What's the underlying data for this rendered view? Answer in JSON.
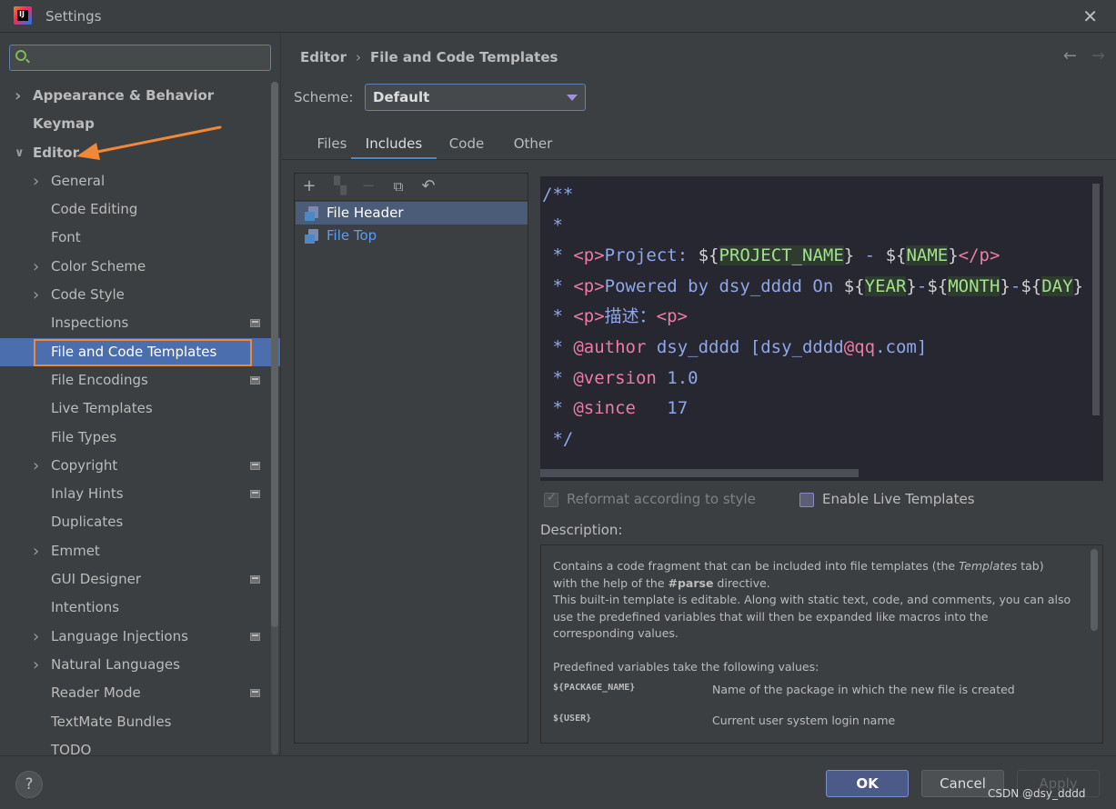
{
  "window": {
    "title": "Settings"
  },
  "search": {
    "placeholder": "",
    "value": ""
  },
  "sidebar": {
    "items": [
      {
        "label": "Appearance & Behavior",
        "level": 0,
        "chevron": "right",
        "bold": true,
        "project_icon": false
      },
      {
        "label": "Keymap",
        "level": 0,
        "chevron": "none",
        "bold": true,
        "project_icon": false
      },
      {
        "label": "Editor",
        "level": 0,
        "chevron": "down",
        "bold": true,
        "project_icon": false
      },
      {
        "label": "General",
        "level": 1,
        "chevron": "right",
        "bold": false,
        "project_icon": false
      },
      {
        "label": "Code Editing",
        "level": 1,
        "chevron": "none",
        "bold": false,
        "project_icon": false
      },
      {
        "label": "Font",
        "level": 1,
        "chevron": "none",
        "bold": false,
        "project_icon": false
      },
      {
        "label": "Color Scheme",
        "level": 1,
        "chevron": "right",
        "bold": false,
        "project_icon": false
      },
      {
        "label": "Code Style",
        "level": 1,
        "chevron": "right",
        "bold": false,
        "project_icon": false
      },
      {
        "label": "Inspections",
        "level": 1,
        "chevron": "none",
        "bold": false,
        "project_icon": true
      },
      {
        "label": "File and Code Templates",
        "level": 1,
        "chevron": "none",
        "bold": false,
        "project_icon": false,
        "selected": true
      },
      {
        "label": "File Encodings",
        "level": 1,
        "chevron": "none",
        "bold": false,
        "project_icon": true
      },
      {
        "label": "Live Templates",
        "level": 1,
        "chevron": "none",
        "bold": false,
        "project_icon": false
      },
      {
        "label": "File Types",
        "level": 1,
        "chevron": "none",
        "bold": false,
        "project_icon": false
      },
      {
        "label": "Copyright",
        "level": 1,
        "chevron": "right",
        "bold": false,
        "project_icon": true
      },
      {
        "label": "Inlay Hints",
        "level": 1,
        "chevron": "none",
        "bold": false,
        "project_icon": true
      },
      {
        "label": "Duplicates",
        "level": 1,
        "chevron": "none",
        "bold": false,
        "project_icon": false
      },
      {
        "label": "Emmet",
        "level": 1,
        "chevron": "right",
        "bold": false,
        "project_icon": false
      },
      {
        "label": "GUI Designer",
        "level": 1,
        "chevron": "none",
        "bold": false,
        "project_icon": true
      },
      {
        "label": "Intentions",
        "level": 1,
        "chevron": "none",
        "bold": false,
        "project_icon": false
      },
      {
        "label": "Language Injections",
        "level": 1,
        "chevron": "right",
        "bold": false,
        "project_icon": true
      },
      {
        "label": "Natural Languages",
        "level": 1,
        "chevron": "right",
        "bold": false,
        "project_icon": false
      },
      {
        "label": "Reader Mode",
        "level": 1,
        "chevron": "none",
        "bold": false,
        "project_icon": true
      },
      {
        "label": "TextMate Bundles",
        "level": 1,
        "chevron": "none",
        "bold": false,
        "project_icon": false
      },
      {
        "label": "TODO",
        "level": 1,
        "chevron": "none",
        "bold": false,
        "project_icon": false
      }
    ]
  },
  "breadcrumb": {
    "parent": "Editor",
    "separator": "›",
    "current": "File and Code Templates"
  },
  "nav": {
    "back": "←",
    "forward": "→"
  },
  "scheme": {
    "label": "Scheme:",
    "value": "Default"
  },
  "tabs": [
    {
      "label": "Files",
      "active": false
    },
    {
      "label": "Includes",
      "active": true
    },
    {
      "label": "Code",
      "active": false
    },
    {
      "label": "Other",
      "active": false
    }
  ],
  "toolbar": {
    "add_icon": "plus-icon",
    "create_child_icon": "create-child-icon",
    "remove_icon": "minus-icon",
    "copy_icon": "copy-icon",
    "reset_icon": "reset-icon"
  },
  "templates": [
    {
      "name": "File Header",
      "selected": true,
      "style": "normal"
    },
    {
      "name": "File Top",
      "selected": false,
      "style": "blue"
    }
  ],
  "code_lines": [
    "/**",
    " *",
    " * <p>Project: ${PROJECT_NAME} - ${NAME}</p>",
    " * <p>Powered by dsy_dddd On ${YEAR}-${MONTH}-${DAY}",
    " * <p>描述：<p>",
    " * @author dsy_dddd [dsy_dddd@qq.com]",
    " * @version 1.0",
    " * @since   17",
    " */"
  ],
  "options": {
    "reformat_label": "Reformat according to style",
    "reformat_checked": true,
    "reformat_enabled": false,
    "live_templates_label": "Enable Live Templates",
    "live_templates_checked": false
  },
  "description": {
    "label": "Description:",
    "p1_a": "Contains a code fragment that can be included into file templates (the ",
    "p1_templates": "Templates",
    "p1_b": " tab) with the help of the ",
    "p1_parse": "#parse",
    "p1_c": " directive.",
    "p2": "This built-in template is editable. Along with static text, code, and comments, you can also use the predefined variables that will then be expanded like macros into the corresponding values.",
    "p3": "Predefined variables take the following values:",
    "variables": [
      {
        "name": "${PACKAGE_NAME}",
        "desc": "Name of the package in which the new file is created"
      },
      {
        "name": "${USER}",
        "desc": "Current user system login name"
      }
    ]
  },
  "footer": {
    "help": "?",
    "ok": "OK",
    "cancel": "Cancel",
    "apply": "Apply",
    "watermark": "CSDN @dsy_dddd"
  },
  "colors": {
    "selection": "#4b6eaf",
    "highlight_box": "#f0883a",
    "annotation_arrow": "#f0883a",
    "editor_bg": "#262730"
  }
}
